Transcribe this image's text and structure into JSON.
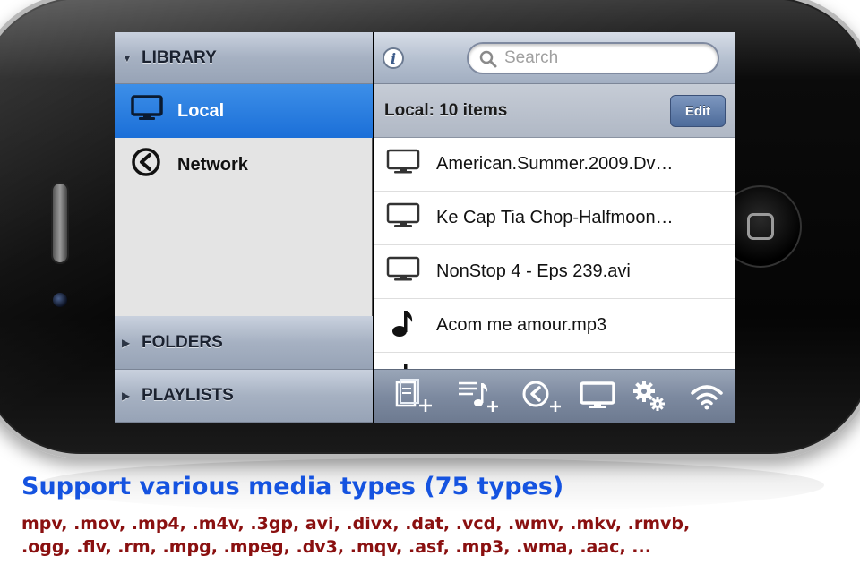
{
  "sidebar": {
    "library_label": "LIBRARY",
    "items": [
      {
        "label": "Local",
        "icon": "monitor-icon",
        "selected": true
      },
      {
        "label": "Network",
        "icon": "network-icon",
        "selected": false
      }
    ],
    "folders_label": "FOLDERS",
    "playlists_label": "PLAYLISTS"
  },
  "topbar": {
    "info_label": "i",
    "search": {
      "placeholder": "Search",
      "value": ""
    }
  },
  "list": {
    "title": "Local: 10 items",
    "edit_label": "Edit",
    "rows": [
      {
        "name": "American.Summer.2009.Dv…",
        "icon": "video-icon"
      },
      {
        "name": "Ke Cap Tia Chop-Halfmoon…",
        "icon": "video-icon"
      },
      {
        "name": "NonStop 4 - Eps 239.avi",
        "icon": "video-icon"
      },
      {
        "name": "Acom me amour.mp3",
        "icon": "music-note-icon"
      }
    ]
  },
  "toolbar": {
    "buttons": [
      {
        "name": "add-folder-icon"
      },
      {
        "name": "add-playlist-icon"
      },
      {
        "name": "add-network-icon"
      },
      {
        "name": "tv-out-icon"
      },
      {
        "name": "settings-icon"
      },
      {
        "name": "wifi-icon"
      }
    ]
  },
  "caption": {
    "title": "Support various media types (75 types)",
    "line1": "mpv, .mov, .mp4, .m4v, .3gp, avi, .divx, .dat, .vcd, .wmv, .mkv, .rmvb,",
    "line2": ".ogg, .flv, .rm, .mpg, .mpeg, .dv3, .mqv, .asf, .mp3, .wma, .aac, ..."
  },
  "colors": {
    "selection": "#1b6fd8",
    "caption_title": "#1553e0",
    "caption_list": "#8a1010"
  }
}
